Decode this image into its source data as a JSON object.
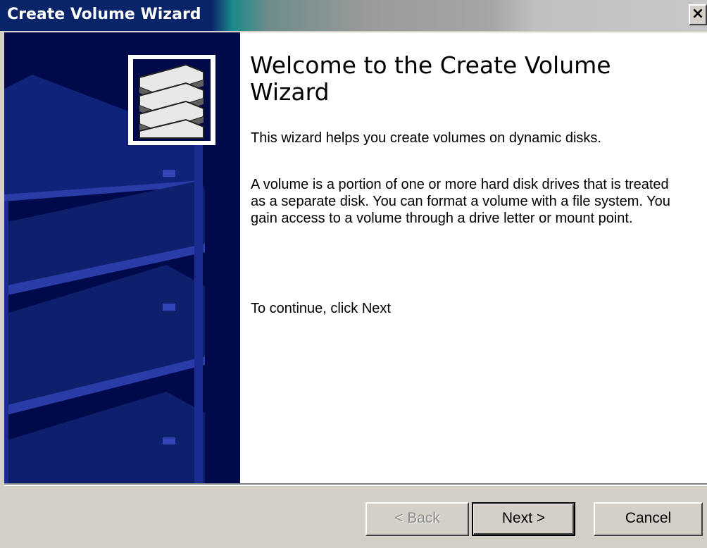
{
  "window": {
    "title": "Create Volume Wizard",
    "close_label": "×"
  },
  "content": {
    "heading": "Welcome to the Create Volume Wizard",
    "intro": "This wizard helps you create volumes on dynamic disks.",
    "description": "A volume is a portion of one or more hard disk drives that is treated as a separate disk. You can format a volume with a file system. You gain access to a volume through a drive letter or mount point.",
    "instruction": "To continue, click Next"
  },
  "buttons": {
    "back": "< Back",
    "next": "Next >",
    "cancel": "Cancel"
  },
  "icons": {
    "wizard_logo": "disk-stack-icon"
  },
  "colors": {
    "title_bar": "#0a246a",
    "side_panel": "#000a4a",
    "dialog_face": "#d4d0c8"
  }
}
